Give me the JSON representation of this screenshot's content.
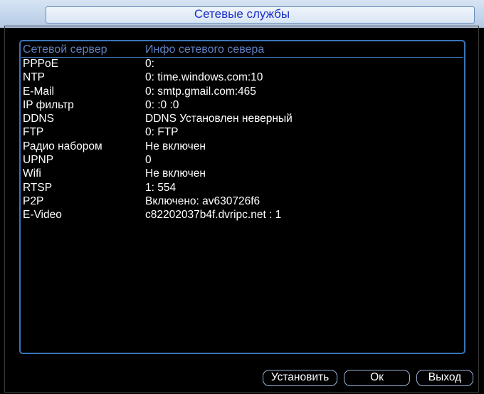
{
  "window": {
    "title": "Сетевые службы"
  },
  "table": {
    "headers": {
      "server": "Сетевой сервер",
      "info": "Инфо сетевого севера"
    },
    "rows": [
      {
        "name": "PPPoE",
        "info": "0:"
      },
      {
        "name": "NTP",
        "info": "0: time.windows.com:10"
      },
      {
        "name": "E-Mail",
        "info": "0: smtp.gmail.com:465"
      },
      {
        "name": "IP фильтр",
        "info": "0: :0 :0"
      },
      {
        "name": "DDNS",
        "info": "DDNS Установлен  неверный"
      },
      {
        "name": "FTP",
        "info": "0: FTP"
      },
      {
        "name": "Радио набором",
        "info": "Не включен"
      },
      {
        "name": "UPNP",
        "info": "0"
      },
      {
        "name": "Wifi",
        "info": "Не включен"
      },
      {
        "name": "RTSP",
        "info": "1: 554"
      },
      {
        "name": "P2P",
        "info": "Включено: av630726f6"
      },
      {
        "name": "E-Video",
        "info": "c82202037b4f.dvripc.net : 1"
      }
    ]
  },
  "buttons": {
    "set": "Установить",
    "ok": "Ок",
    "exit": "Выход"
  },
  "colors": {
    "title_text": "#1b2ec7",
    "accent_border": "#3b74b6",
    "header_text": "#5f7fc0",
    "background": "#000000"
  }
}
